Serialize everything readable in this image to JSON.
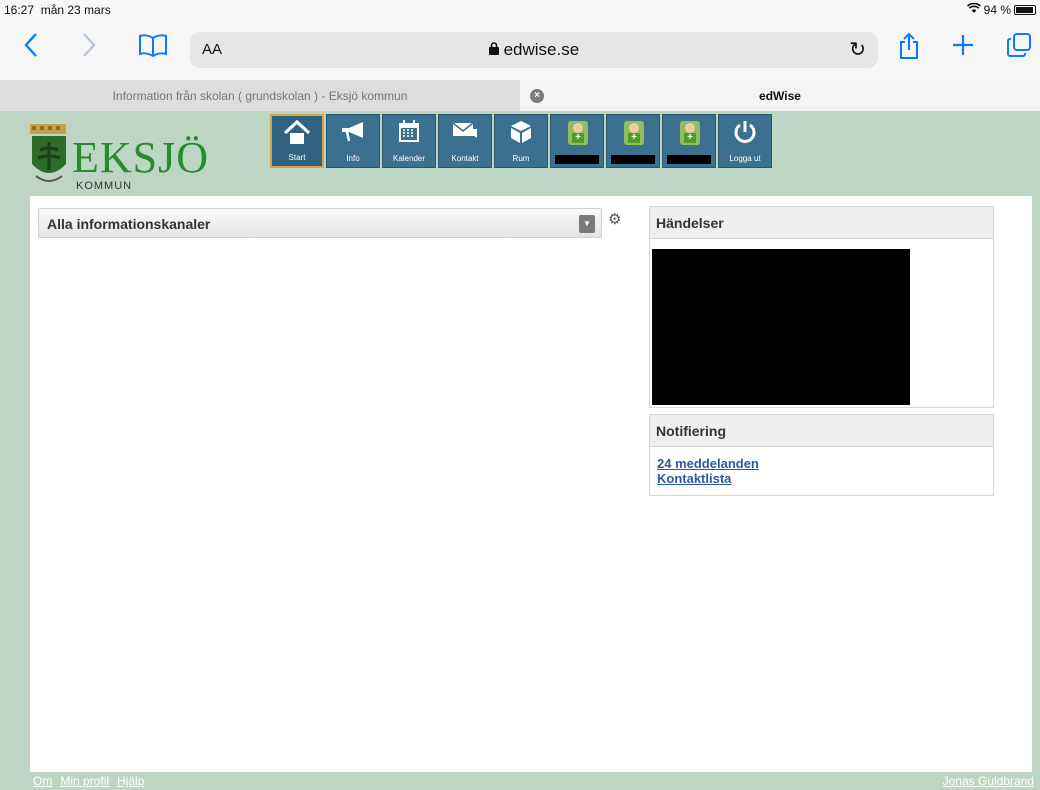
{
  "status_bar": {
    "time": "16:27",
    "date": "mån 23 mars",
    "battery": "94 %",
    "battery_level": 0.94
  },
  "browser": {
    "icons": [
      "back-chevron",
      "forward-chevron",
      "bookmarks-book",
      "share",
      "new-tab-plus",
      "tabs"
    ],
    "text_size_label": "AA",
    "url": "edwise.se",
    "tabs": [
      {
        "label": "Information från skolan ( grundskolan ) - Eksjö kommun"
      },
      {
        "label": "edWise"
      }
    ]
  },
  "logo": {
    "name": "EKSJÖ",
    "subtitle": "KOMMUN"
  },
  "nav": {
    "items": [
      {
        "label": "Start",
        "icon": "home-icon"
      },
      {
        "label": "Info",
        "icon": "megaphone-icon"
      },
      {
        "label": "Kalender",
        "icon": "calendar-icon"
      },
      {
        "label": "Kontakt",
        "icon": "mail-icon"
      },
      {
        "label": "Rum",
        "icon": "cube-icon"
      },
      {
        "label": "",
        "icon": "student-avatar-icon"
      },
      {
        "label": "",
        "icon": "student-avatar-icon"
      },
      {
        "label": "",
        "icon": "student-avatar-icon"
      },
      {
        "label": "Logga ut",
        "icon": "power-icon"
      }
    ]
  },
  "main": {
    "channel_select": "Alla informationskanaler"
  },
  "events_panel": {
    "title": "Händelser"
  },
  "notification_panel": {
    "title": "Notifiering",
    "links": [
      "24 meddelanden",
      "Kontaktlista"
    ]
  },
  "footer": {
    "links": [
      "Om",
      "Min profil",
      "Hjälp"
    ],
    "user": "Jonas Guldbrand"
  },
  "colors": {
    "accent": "#0a7aff",
    "page_bg": "#bdd6c3",
    "nav_bg": "#3b708f",
    "link": "#2c5aa0"
  }
}
